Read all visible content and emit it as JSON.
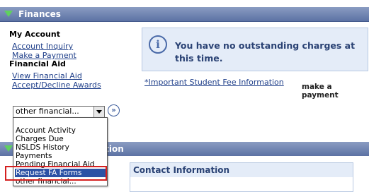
{
  "header": {
    "title": "Finances"
  },
  "my_account": {
    "heading": "My Account",
    "links": [
      "Account Inquiry",
      "Make a Payment"
    ]
  },
  "financial_aid": {
    "heading": "Financial Aid",
    "links": [
      "View Financial Aid",
      "Accept/Decline Awards"
    ]
  },
  "info_message": {
    "text": "You have no outstanding charges at this time."
  },
  "links": {
    "fee_info": "*Important Student Fee Information",
    "make_payment": "make a payment"
  },
  "select": {
    "value": "other financial...",
    "go_icon": "double-chevron-right-icon",
    "options": [
      "Account Activity",
      "Charges Due",
      "NSLDS History",
      "Payments",
      "Pending Financial Aid",
      "Request FA Forms",
      "other financial..."
    ],
    "selected_index": 5
  },
  "section2": {
    "title_visible": "ation"
  },
  "contact": {
    "title": "Contact Information"
  },
  "colors": {
    "header": "#5c72a4",
    "accent": "#2b52a5",
    "highlight": "#d42020"
  }
}
